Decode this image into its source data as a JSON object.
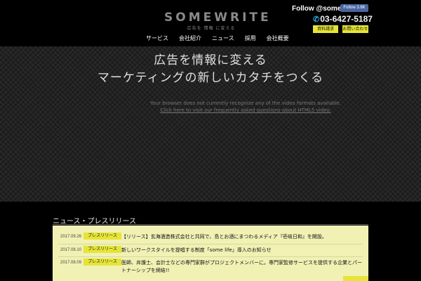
{
  "header": {
    "logo": {
      "text": "SOMEWRITE",
      "tagline": "広告を 情報 に変える"
    },
    "follow_text": "Follow @somewrite",
    "fb_button": "Follow 3.6K",
    "phone": "03-6427-5187",
    "buttons": {
      "docs": "資料請求",
      "contact": "お問い合わせ"
    },
    "nav": [
      "サービス",
      "会社紹介",
      "ニュース",
      "採用",
      "会社概要"
    ]
  },
  "hero": {
    "line1": "広告を情報に変える",
    "line2": "マーケティングの新しいカタチをつくる",
    "video_msg": "Your browser does not currently recognize any of the video formats available.",
    "video_link": "Click here to visit our frequently asked questions about HTML5 video."
  },
  "news": {
    "title": "ニュース・プレスリリース",
    "items": [
      {
        "date": "2017.09.26",
        "badge": "プレスリリース",
        "text": "【リリース】玄海酒造株式会社と共同で、島とお酒にまつわるメディア『壱岐日和』を開設。"
      },
      {
        "date": "2017.08.10",
        "badge": "プレスリリース",
        "text": "新しいワークスタイルを提唱する制度「some life」導入のお知らせ"
      },
      {
        "date": "2017.08.09",
        "badge": "プレスリリース",
        "text": "医師、弁護士、会計士などの専門家群がプロジェクトメンバーに。専門家監修サービスを提供する企業とパートナーシップを締結!!"
      }
    ]
  },
  "colors": {
    "accent_yellow": "#e6e436",
    "news_bg": "#f1f1b4",
    "phone_icon": "#2aa3d8"
  }
}
